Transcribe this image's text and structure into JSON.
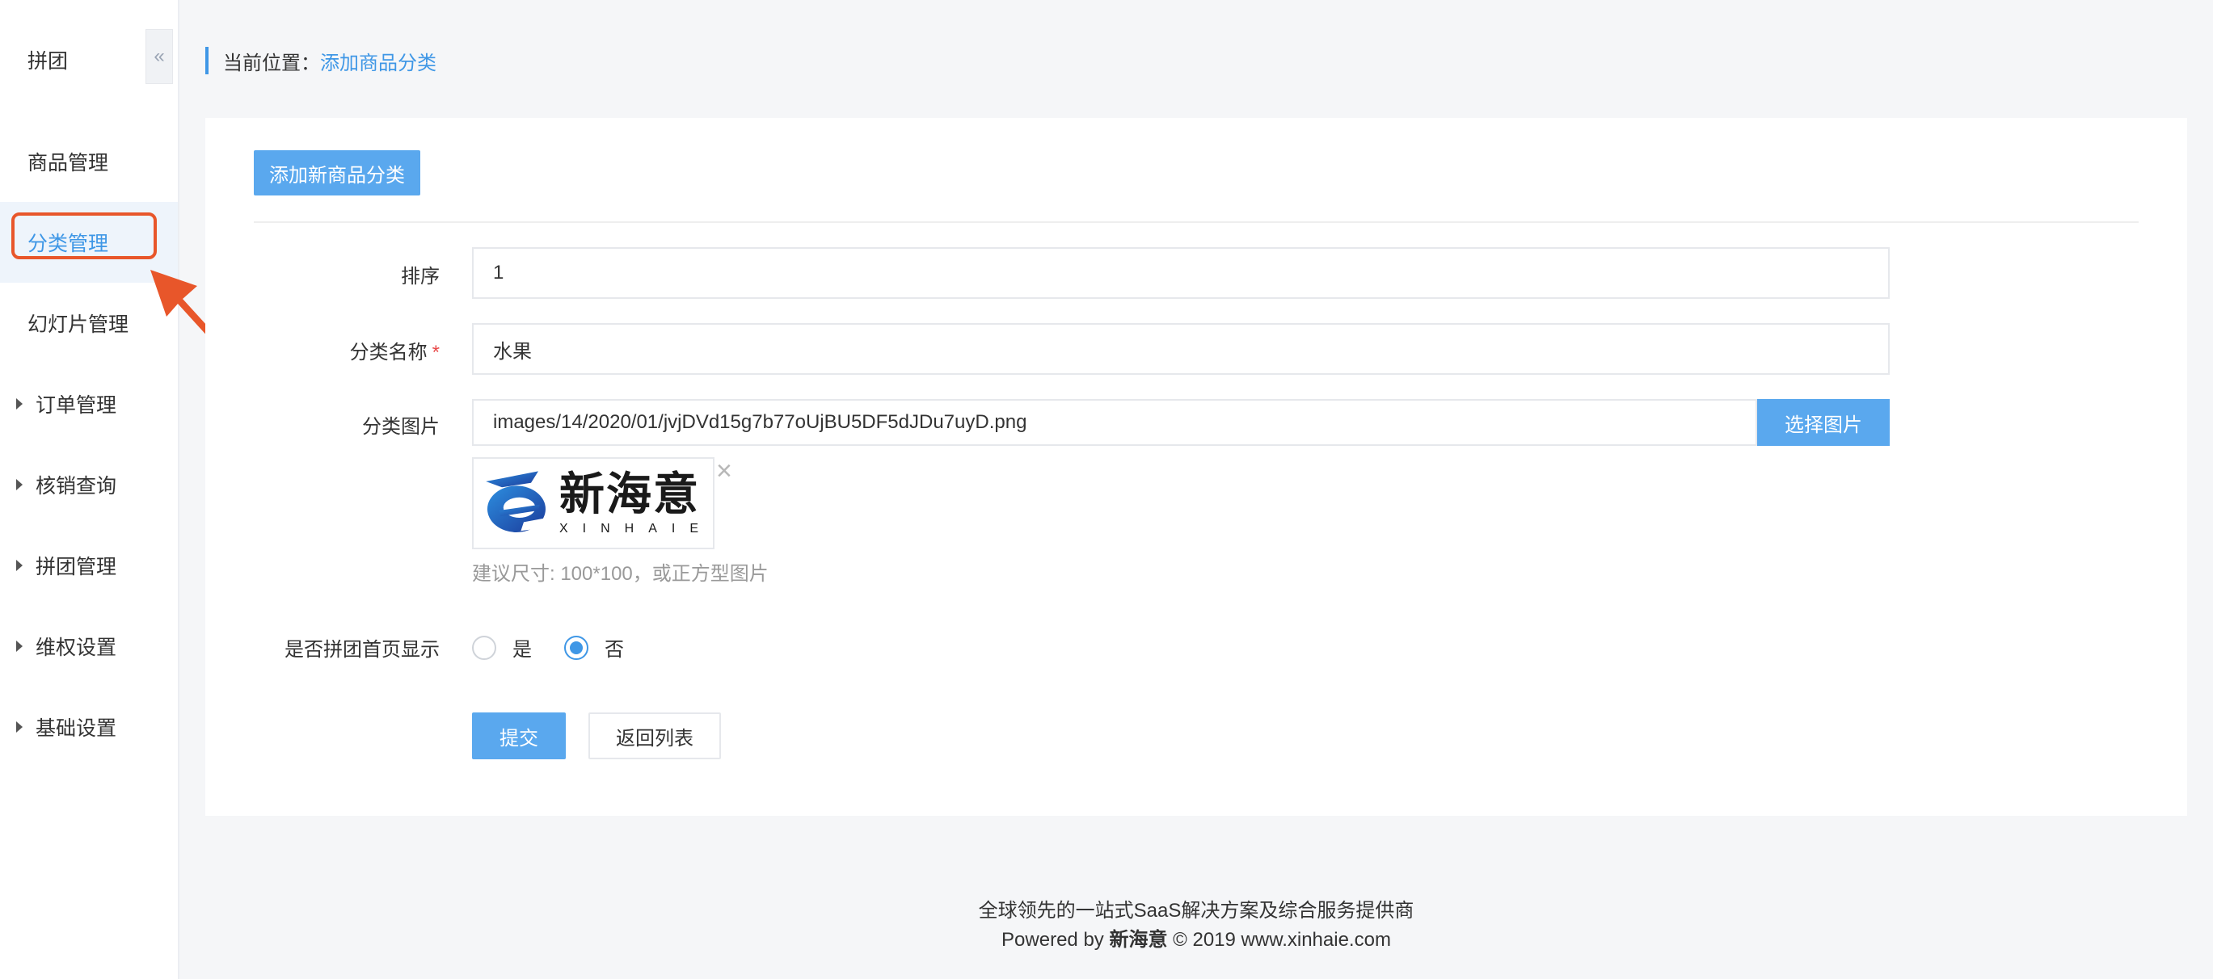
{
  "sidebar": {
    "title": "拼团",
    "collapse_icon": "«",
    "items": [
      {
        "label": "商品管理",
        "group": false,
        "active": false
      },
      {
        "label": "分类管理",
        "group": false,
        "active": true
      },
      {
        "label": "幻灯片管理",
        "group": false,
        "active": false
      },
      {
        "label": "订单管理",
        "group": true,
        "active": false
      },
      {
        "label": "核销查询",
        "group": true,
        "active": false
      },
      {
        "label": "拼团管理",
        "group": true,
        "active": false
      },
      {
        "label": "维权设置",
        "group": true,
        "active": false
      },
      {
        "label": "基础设置",
        "group": true,
        "active": false
      }
    ]
  },
  "breadcrumb": {
    "prefix": "当前位置：",
    "current": "添加商品分类"
  },
  "main": {
    "add_button": "添加新商品分类",
    "form": {
      "sort": {
        "label": "排序",
        "value": "1"
      },
      "name": {
        "label": "分类名称",
        "required_mark": "*",
        "value": "水果"
      },
      "image": {
        "label": "分类图片",
        "value": "images/14/2020/01/jvjDVd15g7b77oUjBU5DF5dJDu7uyD.png",
        "choose_button": "选择图片",
        "remove_icon": "×",
        "logo_cn": "新海意",
        "logo_en": "XINHAIE",
        "hint": "建议尺寸: 100*100，或正方型图片"
      },
      "home_display": {
        "label": "是否拼团首页显示",
        "options": [
          {
            "label": "是",
            "checked": false
          },
          {
            "label": "否",
            "checked": true
          }
        ]
      }
    },
    "submit_button": "提交",
    "back_button": "返回列表"
  },
  "footer": {
    "line1": "全球领先的一站式SaaS解决方案及综合服务提供商",
    "line2_prefix": "Powered by ",
    "line2_brand": "新海意",
    "line2_suffix": " © 2019 www.xinhaie.com"
  },
  "colors": {
    "accent": "#3f97e6",
    "button": "#5aa8ee",
    "annotation": "#e8562a",
    "required": "#e84a4a"
  }
}
